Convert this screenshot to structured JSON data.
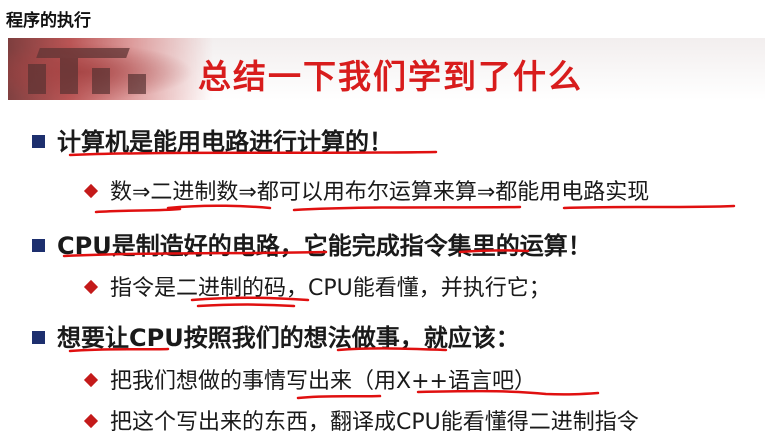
{
  "window": {
    "title": "程序的执行"
  },
  "slide": {
    "title": "总结一下我们学到了什么",
    "bullets": [
      {
        "level": 1,
        "text": "计算机是能用电路进行计算的！"
      },
      {
        "level": 2,
        "text": "数⇒二进制数⇒都可以用布尔运算来算⇒都能用电路实现"
      },
      {
        "level": 1,
        "text": "CPU是制造好的电路，它能完成指令集里的运算！"
      },
      {
        "level": 2,
        "text": "指令是二进制的码，CPU能看懂，并执行它；"
      },
      {
        "level": 1,
        "text": "想要让CPU按照我们的想法做事，就应该："
      },
      {
        "level": 2,
        "text": "把我们想做的事情写出来（用X++语言吧）"
      },
      {
        "level": 2,
        "text": "把这个写出来的东西，翻译成CPU能看懂得二进制指令"
      }
    ]
  },
  "colors": {
    "title": "#d81c1c",
    "bullet_square": "#1d2f6e",
    "bullet_diamond": "#c41a1a",
    "annotation_ink": "#e01010"
  }
}
